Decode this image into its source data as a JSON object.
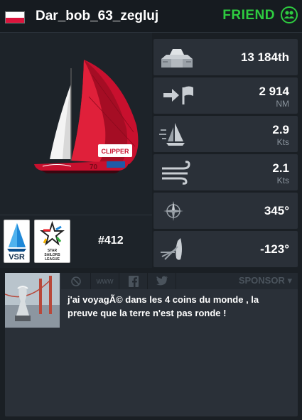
{
  "header": {
    "username": "Dar_bob_63_zegluj",
    "friend_label": "FRIEND",
    "flag_icon": "poland-flag-icon",
    "friend_icon": "friends-icon"
  },
  "boat": {
    "number": "#412",
    "logos": {
      "vsr": "VSR",
      "ssl_line1": "STAR",
      "ssl_line2": "SAILORS",
      "ssl_line3": "LEAGUE"
    },
    "hull_text": "CLIPPER"
  },
  "stats": {
    "rank": {
      "value": "13 184th",
      "icon": "podium-icon"
    },
    "distance": {
      "value": "2 914",
      "unit": "NM",
      "icon": "distance-to-finish-icon"
    },
    "boat_speed": {
      "value": "2.9",
      "unit": "Kts",
      "icon": "sail-speed-icon"
    },
    "wind_speed": {
      "value": "2.1",
      "unit": "Kts",
      "icon": "wind-icon"
    },
    "heading": {
      "value": "345°",
      "icon": "compass-icon"
    },
    "twa": {
      "value": "-123°",
      "icon": "wind-angle-icon"
    }
  },
  "profile": {
    "toolbar": {
      "block_icon": "block-icon",
      "www_label": "www",
      "facebook_icon": "facebook-icon",
      "twitter_icon": "twitter-icon",
      "sponsor_label": "SPONSOR"
    },
    "bio": "j'ai voyagÃ© dans les 4 coins du monde , la preuve que la terre n'est pas ronde !"
  },
  "colors": {
    "accent_green": "#2ecc40",
    "panel": "#2a3038",
    "background": "#1a1f24",
    "sail_red": "#c8102e"
  }
}
